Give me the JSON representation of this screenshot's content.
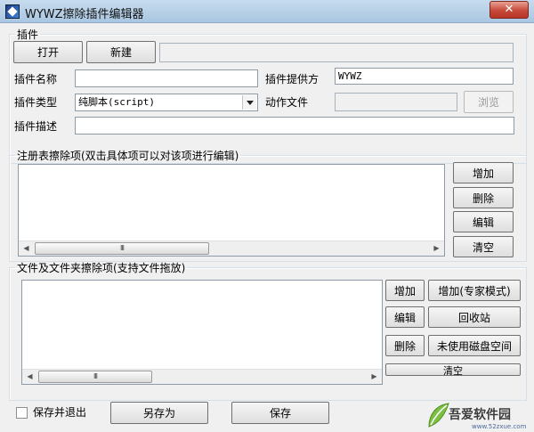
{
  "window": {
    "title": "WYWZ擦除插件编辑器",
    "close_label": "✕"
  },
  "plugin_group": {
    "legend": "插件",
    "open_label": "打开",
    "new_label": "新建",
    "path_value": "",
    "name_label": "插件名称",
    "name_value": "",
    "provider_label": "插件提供方",
    "provider_value": "WYWZ",
    "type_label": "插件类型",
    "type_value": "纯脚本(script)",
    "action_file_label": "动作文件",
    "action_file_value": "",
    "browse_label": "浏览",
    "desc_label": "插件描述",
    "desc_value": ""
  },
  "registry_group": {
    "legend": "注册表擦除项(双击具体项可以对该项进行编辑)",
    "add_label": "增加",
    "delete_label": "删除",
    "edit_label": "编辑",
    "clear_label": "清空",
    "thumb_grip": "III"
  },
  "files_group": {
    "legend": "文件及文件夹擦除项(支持文件拖放)",
    "add_label": "增加",
    "add_expert_label": "增加(专家模式)",
    "edit_label": "编辑",
    "recycle_label": "回收站",
    "delete_label": "删除",
    "unused_disk_label": "未使用磁盘空间",
    "clear_label": "清空",
    "thumb_grip": "III"
  },
  "footer": {
    "save_exit_label": "保存并退出",
    "save_as_label": "另存为",
    "save_label": "保存"
  },
  "watermark": {
    "text": "吾爱软件园",
    "url": "www.52zxue.com"
  },
  "colors": {
    "close_button": "#c6493a",
    "titlebar": "#b9d1ea",
    "window_bg": "#f0f0f0"
  }
}
